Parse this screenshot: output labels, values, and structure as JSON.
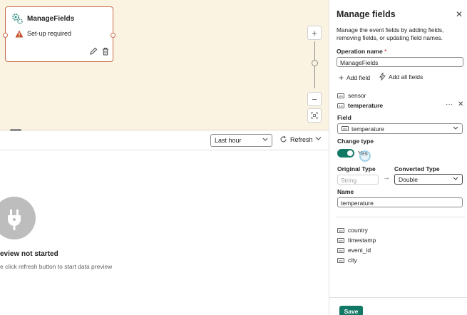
{
  "node": {
    "title": "ManageFields",
    "status": "Set-up required"
  },
  "preview": {
    "time_range": "Last hour",
    "refresh_label": "Refresh",
    "empty_title": "eview not started",
    "empty_subtitle": "e click refresh button to start data preview"
  },
  "panel": {
    "title": "Manage fields",
    "description": "Manage the event fields by adding fields, removing fields, or updating field names.",
    "operation_name_label": "Operation name",
    "required_marker": "*",
    "operation_name_value": "ManageFields",
    "add_field_label": "Add field",
    "add_all_fields_label": "Add all fields",
    "fields_top": [
      {
        "name": "sensor",
        "selected": false
      },
      {
        "name": "temperature",
        "selected": true
      }
    ],
    "editor": {
      "field_label": "Field",
      "field_value": "temperature",
      "change_type_label": "Change type",
      "toggle_label": "Yes",
      "original_type_label": "Original Type",
      "original_type_value": "String",
      "converted_type_label": "Converted Type",
      "converted_type_value": "Double",
      "name_label": "Name",
      "name_value": "temperature"
    },
    "fields_bottom": [
      {
        "name": "country"
      },
      {
        "name": "timestamp"
      },
      {
        "name": "event_id"
      },
      {
        "name": "city"
      }
    ],
    "save_label": "Save"
  },
  "colors": {
    "accent": "#117865",
    "node_border": "#c86b4a",
    "canvas_bg": "#faf3e1",
    "warning": "#c4512b"
  }
}
